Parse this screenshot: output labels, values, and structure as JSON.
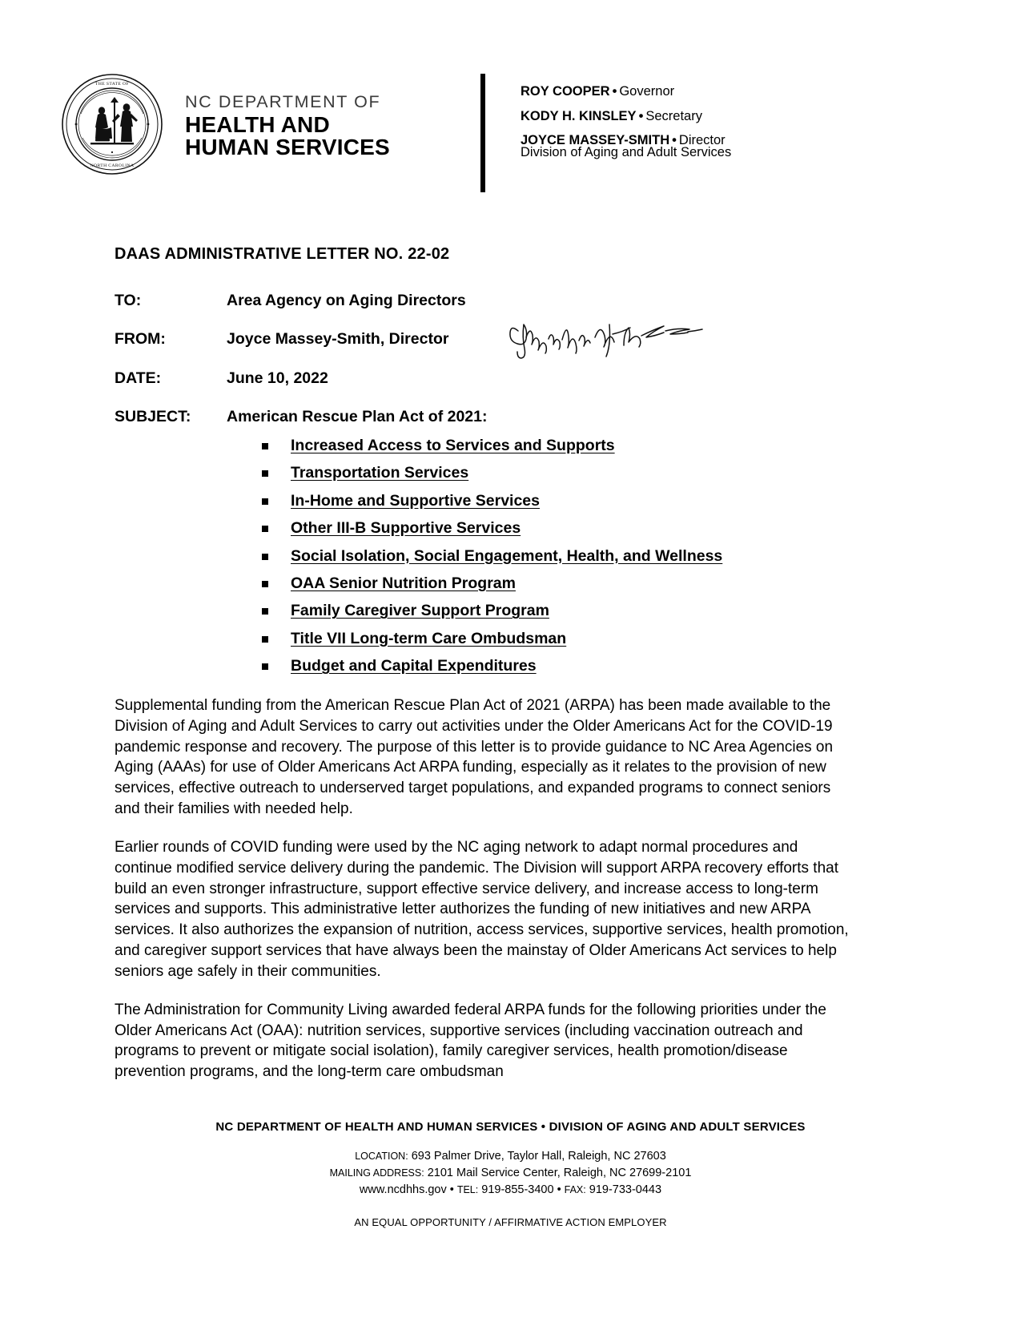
{
  "letterhead": {
    "seal_name": "great-seal-of-the-state-of-north-carolina",
    "dept_line1": "NC DEPARTMENT OF",
    "dept_line2": "HEALTH AND",
    "dept_line3": "HUMAN SERVICES",
    "officials": [
      {
        "name": "ROY COOPER",
        "separator": "•",
        "title": "Governor"
      },
      {
        "name": "KODY H. KINSLEY",
        "separator": "•",
        "title": "Secretary"
      },
      {
        "name": "JOYCE MASSEY-SMITH",
        "separator": "•",
        "title": "Director"
      }
    ],
    "division_line": "Division of Aging and Adult Services"
  },
  "document": {
    "title": "DAAS ADMINISTRATIVE LETTER NO. 22-02",
    "memo": {
      "to_label": "TO:",
      "to_value": "Area Agency on Aging Directors",
      "from_label": "FROM:",
      "from_value": "Joyce Massey-Smith, Director",
      "signature_alt": "Joyce Massey-Smith handwritten signature",
      "date_label": "DATE:",
      "date_value": "June 10, 2022",
      "subject_label": "SUBJECT:",
      "subject_value": "American Rescue Plan Act of 2021:"
    },
    "subject_items": [
      "Increased Access to Services and Supports",
      "Transportation Services",
      "In-Home and Supportive Services",
      "Other III-B Supportive Services",
      "Social Isolation, Social Engagement, Health, and Wellness",
      "OAA Senior Nutrition Program",
      "Family Caregiver Support Program",
      "Title VII Long-term Care Ombudsman",
      "Budget and Capital Expenditures"
    ],
    "paragraphs": [
      "Supplemental funding from the American Rescue Plan Act of 2021 (ARPA) has been made available to the Division of Aging and Adult Services to carry out activities under the Older Americans Act for the COVID-19 pandemic response and recovery.  The purpose of this letter is to provide guidance to NC Area Agencies on Aging (AAAs) for use of Older Americans Act ARPA funding, especially as it relates to the provision of new services, effective outreach to underserved target populations, and expanded programs to connect seniors and their families with needed help.",
      "Earlier rounds of COVID funding were used by the NC aging network to adapt normal procedures and continue modified service delivery during the pandemic.  The Division will support ARPA recovery efforts that build an even stronger infrastructure, support effective service delivery, and increase access to long-term services and supports.  This administrative letter authorizes the funding of new initiatives and new ARPA services.  It also authorizes the expansion of nutrition, access services, supportive services, health promotion, and caregiver support services that have always been the mainstay of Older Americans Act services to help seniors age safely in their communities.",
      "The Administration for Community Living awarded federal ARPA funds for the following priorities under the Older Americans Act (OAA):  nutrition services, supportive services (including vaccination outreach and programs to prevent or mitigate social isolation), family caregiver services, health promotion/disease prevention programs, and the long-term care ombudsman"
    ]
  },
  "footer": {
    "title": "NC DEPARTMENT OF HEALTH AND HUMAN SERVICES  •  DIVISION OF AGING AND ADULT SERVICES",
    "location_label": "LOCATION:",
    "location_value": "693 Palmer Drive, Taylor Hall, Raleigh, NC 27603",
    "mailing_label": "MAILING ADDRESS:",
    "mailing_value": "2101 Mail Service Center, Raleigh, NC 27699-2101",
    "website": "www.ncdhhs.gov",
    "tel_label": "TEL:",
    "tel_value": "919-855-3400",
    "fax_label": "FAX:",
    "fax_value": "919-733-0443",
    "equal_opportunity": "AN EQUAL OPPORTUNITY / AFFIRMATIVE ACTION EMPLOYER",
    "separator": "•"
  }
}
